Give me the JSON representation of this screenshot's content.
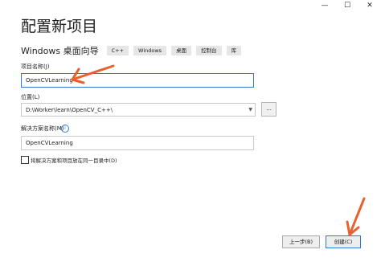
{
  "window": {
    "minimize": "—",
    "maximize": "☐",
    "close": "✕"
  },
  "page": {
    "title": "配置新项目"
  },
  "template": {
    "name": "Windows 桌面向导",
    "tags": [
      "C++",
      "Windows",
      "桌面",
      "控制台",
      "库"
    ]
  },
  "project_name": {
    "label": "项目名称(J)",
    "value": "OpenCVLearning"
  },
  "location": {
    "label": "位置(L)",
    "value": "D:\\Worker\\learn\\OpenCV_C++\\",
    "browse_label": "..."
  },
  "solution_name": {
    "label": "解决方案名称(M)",
    "value": "OpenCVLearning"
  },
  "options": {
    "same_dir_label": "将解决方案和项目放在同一目录中(D)",
    "same_dir_checked": false
  },
  "footer": {
    "back_label": "上一步(B)",
    "create_label": "创建(C)"
  },
  "colors": {
    "accent": "#2b79d4",
    "annotation_arrow": "#e8602c"
  }
}
